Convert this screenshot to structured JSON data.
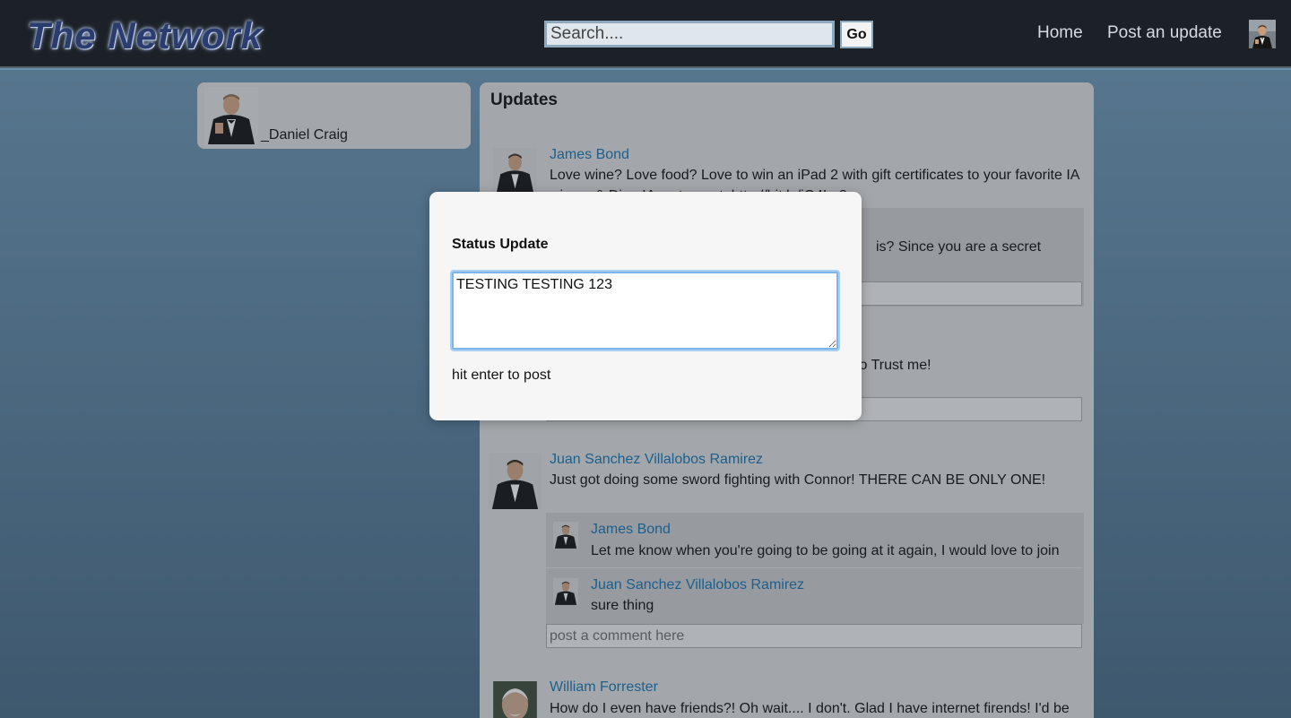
{
  "header": {
    "logo": "The Network",
    "search_placeholder": "Search....",
    "go_label": "Go",
    "nav": {
      "home": "Home",
      "post": "Post an update"
    }
  },
  "profile": {
    "name": "_Daniel Craig"
  },
  "updates": {
    "title": "Updates",
    "posts": [
      {
        "author": "James Bond",
        "text": "Love wine? Love food? Love to win an iPad 2 with gift certificates to your favorite IA",
        "text_partial": "winery & Dine IA restaurant. http://bit.ly/iO4Lo8",
        "comments": [
          {
            "text_partial": "is? Since you are a secret"
          }
        ],
        "comment_placeholder": "post a comment here"
      },
      {
        "text_partial": "lo Trust me!",
        "comment_placeholder": "post a comment here"
      },
      {
        "author": "Juan Sanchez Villalobos Ramirez",
        "text": "Just got doing some sword fighting with Connor! THERE CAN BE ONLY ONE!",
        "comments": [
          {
            "author": "James Bond",
            "text": "Let me know when you're going to be going at it again, I would love to join"
          },
          {
            "author": "Juan Sanchez Villalobos Ramirez",
            "text": "sure thing"
          }
        ],
        "comment_placeholder": "post a comment here"
      },
      {
        "author": "William Forrester",
        "text": "How do I even have friends?! Oh wait.... I don't. Glad I have internet firends! I'd be"
      }
    ]
  },
  "modal": {
    "title": "Status Update",
    "textarea_value": "TESTING TESTING 123",
    "hint": "hit enter to post"
  },
  "colors": {
    "header_bg": "#1c2127",
    "link": "#1a6fa8",
    "panel_bg": "#d3d3d3",
    "modal_bg": "#f6f6f6",
    "focus_ring": "#7cb4ea"
  },
  "icons": {
    "avatar": "tuxedo-portrait-avatar",
    "old-man-avatar": "white-haired-portrait-avatar"
  }
}
